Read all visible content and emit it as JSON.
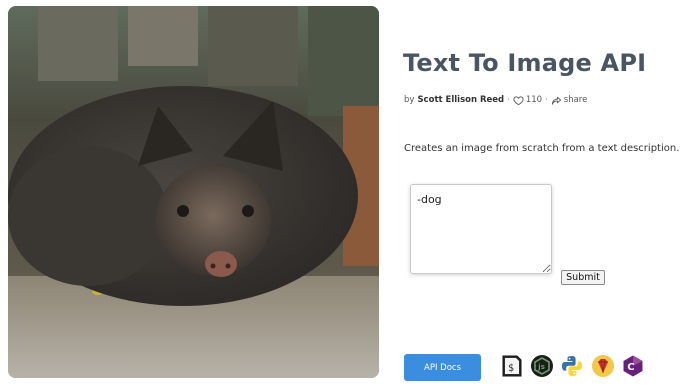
{
  "hero": {
    "subject": "wild boar piglet lying on dirt ground"
  },
  "header": {
    "title": "Text To Image API"
  },
  "meta": {
    "by": "by",
    "author": "Scott Ellison Reed",
    "dot1": "·",
    "likes": "110",
    "dot2": "·",
    "share": "share",
    "like_icon": "heart-icon",
    "share_icon": "share-icon"
  },
  "description": "Creates an image from scratch from a text description.",
  "form": {
    "prompt_value": "-dog",
    "submit_label": "Submit"
  },
  "footer": {
    "docs_label": "API Docs",
    "languages": [
      "shell",
      "nodejs",
      "python",
      "ruby",
      "csharp"
    ]
  },
  "colors": {
    "accent": "#3b8de0",
    "title": "#4a5563"
  }
}
